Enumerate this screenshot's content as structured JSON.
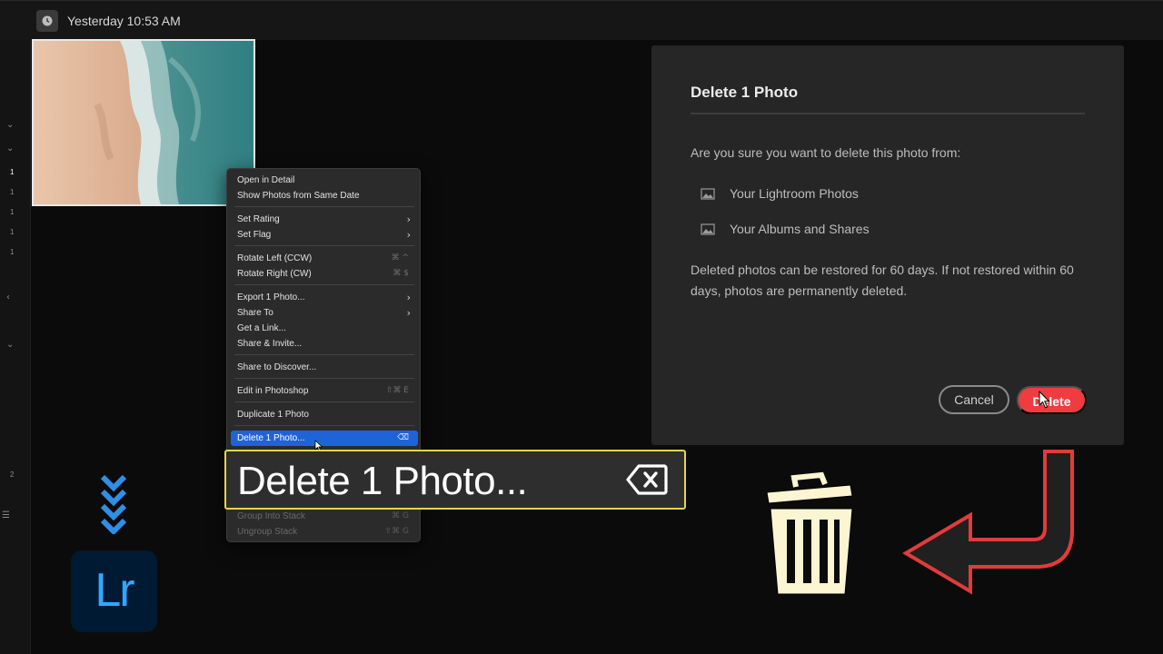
{
  "topbar": {
    "date_label": "Yesterday 10:53 AM",
    "icon": "clock-icon"
  },
  "leftrail": {
    "numbers": [
      "1",
      "1",
      "1",
      "1",
      "1",
      "2"
    ]
  },
  "context_menu": {
    "items": [
      {
        "label": "Open in Detail",
        "shortcut": "",
        "submenu": false
      },
      {
        "label": "Show Photos from Same Date",
        "shortcut": "",
        "submenu": false
      },
      {
        "label": "Set Rating",
        "shortcut": "",
        "submenu": true
      },
      {
        "label": "Set Flag",
        "shortcut": "",
        "submenu": true
      },
      {
        "label": "Rotate Left (CCW)",
        "shortcut": "⌘ ^",
        "submenu": false
      },
      {
        "label": "Rotate Right (CW)",
        "shortcut": "⌘ $",
        "submenu": false
      },
      {
        "label": "Export 1 Photo...",
        "shortcut": "",
        "submenu": true
      },
      {
        "label": "Share To",
        "shortcut": "",
        "submenu": true
      },
      {
        "label": "Get a Link...",
        "shortcut": "",
        "submenu": false
      },
      {
        "label": "Share & Invite...",
        "shortcut": "",
        "submenu": false
      },
      {
        "label": "Share to Discover...",
        "shortcut": "",
        "submenu": false
      },
      {
        "label": "Edit in Photoshop",
        "shortcut": "⇧⌘ E",
        "submenu": false
      },
      {
        "label": "Duplicate 1 Photo",
        "shortcut": "",
        "submenu": false
      },
      {
        "label": "Delete 1 Photo...",
        "shortcut": "⌫",
        "submenu": false,
        "highlighted": true
      },
      {
        "label": "Group Into Stack",
        "shortcut": "⌘ G",
        "submenu": false,
        "disabled": true
      },
      {
        "label": "Ungroup Stack",
        "shortcut": "⇧⌘ G",
        "submenu": false,
        "disabled": true
      }
    ]
  },
  "callout": {
    "label": "Delete 1 Photo...",
    "icon": "delete-key-icon",
    "border_color": "#e8d44a"
  },
  "dialog": {
    "title": "Delete 1 Photo",
    "question": "Are you sure you want to delete this photo from:",
    "locations": [
      {
        "label": "Your Lightroom Photos",
        "icon": "photo-icon"
      },
      {
        "label": "Your Albums and Shares",
        "icon": "photo-icon"
      }
    ],
    "note": "Deleted photos can be restored for 60 days. If not restored within 60 days, photos are permanently deleted.",
    "cancel_label": "Cancel",
    "delete_label": "Delete",
    "delete_color": "#f03c40"
  },
  "logo": {
    "text": "Lr",
    "color": "#31a8ff",
    "background": "#001a33"
  },
  "decor": {
    "chevron_color": "#2f8fe6",
    "arrow_color": "#e23b3b",
    "trash_fill": "#fbf5d2"
  }
}
